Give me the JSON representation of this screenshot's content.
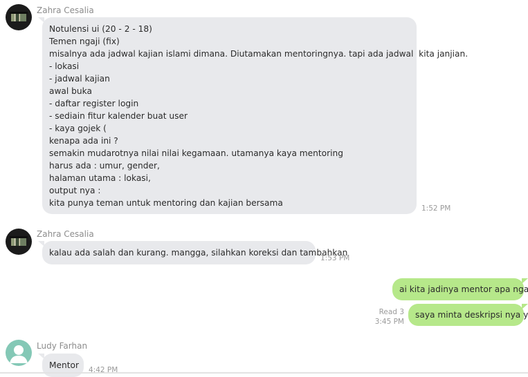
{
  "messages": [
    {
      "sender": "Zahra Cesalia",
      "lines": [
        "Notulensi ui (20 - 2 - 18)",
        "Temen ngaji (fix)",
        "misalnya ada jadwal kajian islami dimana. Diutamakan mentoringnya. tapi ada jadwal  kita janjian.",
        "- lokasi",
        "- jadwal kajian",
        "awal buka",
        "- daftar register login",
        "- sediain fitur kalender buat user",
        "- kaya gojek (",
        "kenapa ada ini ?",
        "semakin mudarotnya nilai nilai kegamaan. utamanya kaya mentoring",
        "harus ada : umur, gender,",
        "halaman utama : lokasi,",
        "output nya :",
        "kita punya teman untuk mentoring dan kajian bersama"
      ],
      "time": "1:52 PM"
    },
    {
      "sender": "Zahra Cesalia",
      "text": "kalau ada salah dan kurang. mangga, silahkan koreksi dan tambahkan",
      "time": "1:53 PM"
    },
    {
      "text": "ai kita jadinya mentor apa ngaji"
    },
    {
      "text": "saya minta deskripsi nya ya",
      "read": "Read 3",
      "time": "3:45 PM"
    },
    {
      "sender": "Ludy Farhan",
      "text": "Mentor",
      "time": "4:42 PM"
    }
  ],
  "colors": {
    "incoming_bubble": "#e8e9ec",
    "outgoing_bubble": "#b6e88a",
    "avatar_teal": "#84c8b6"
  }
}
